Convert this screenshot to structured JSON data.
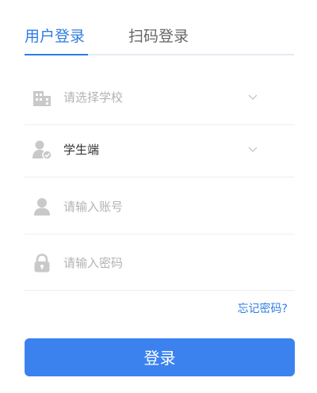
{
  "tabs": {
    "user_login": "用户登录",
    "qr_login": "扫码登录"
  },
  "form": {
    "school_placeholder": "请选择学校",
    "role_value": "学生端",
    "account_placeholder": "请输入账号",
    "password_placeholder": "请输入密码"
  },
  "forgot_password": "忘记密码?",
  "login_button": "登录",
  "icons": {
    "school": "building-icon",
    "role": "user-check-icon",
    "account": "user-icon",
    "password": "lock-icon",
    "dropdown": "chevron-down-icon"
  },
  "colors": {
    "accent": "#2f7de1",
    "button": "#3b82ef",
    "icon": "#c9c9c9",
    "placeholder": "#b3b3b3"
  }
}
